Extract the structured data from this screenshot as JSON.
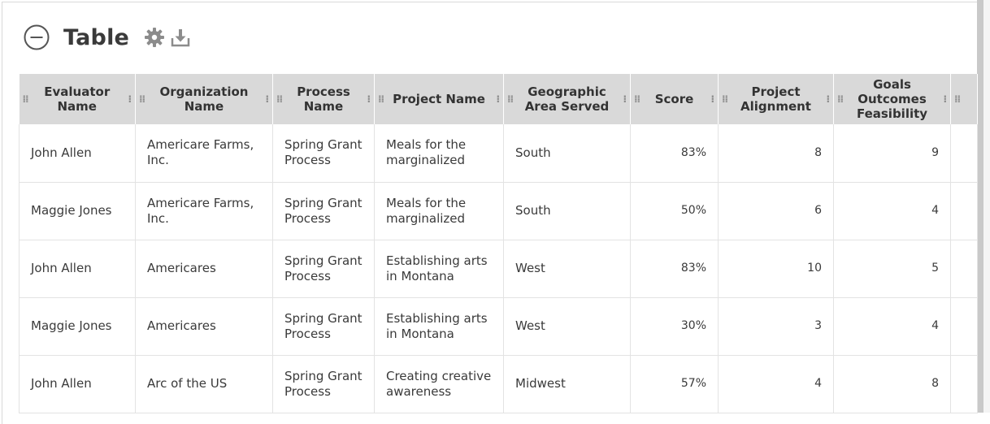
{
  "header": {
    "title": "Table",
    "icons": [
      "collapse-circle-minus-icon",
      "gear-icon",
      "download-icon"
    ]
  },
  "table": {
    "columns": [
      "Evaluator Name",
      "Organization Name",
      "Process Name",
      "Project Name",
      "Geographic Area Served",
      "Score",
      "Project Alignment",
      "Goals Outcomes Feasibility"
    ],
    "rows": [
      [
        "John Allen",
        "Americare Farms, Inc.",
        "Spring Grant Process",
        "Meals for the marginalized",
        "South",
        "83%",
        "8",
        "9"
      ],
      [
        "Maggie Jones",
        "Americare Farms, Inc.",
        "Spring Grant Process",
        "Meals for the marginalized",
        "South",
        "50%",
        "6",
        "4"
      ],
      [
        "John Allen",
        "Americares",
        "Spring Grant Process",
        "Establishing arts in Montana",
        "West",
        "83%",
        "10",
        "5"
      ],
      [
        "Maggie Jones",
        "Americares",
        "Spring Grant Process",
        "Establishing arts in Montana",
        "West",
        "30%",
        "3",
        "4"
      ],
      [
        "John Allen",
        "Arc of the US",
        "Spring Grant Process",
        "Creating creative awareness",
        "Midwest",
        "57%",
        "4",
        "8"
      ]
    ]
  },
  "colors": {
    "header_bg": "#d9d9d9",
    "text": "#333333",
    "border": "#e3e3e3"
  }
}
